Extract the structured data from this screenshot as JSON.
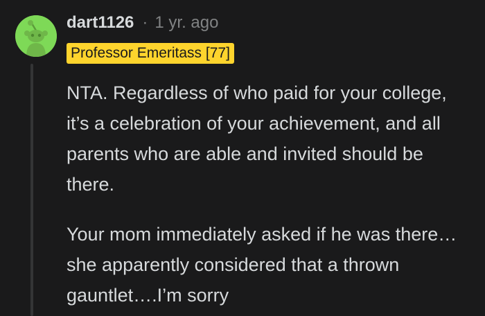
{
  "comment": {
    "username": "dart1126",
    "separator": "·",
    "timestamp": "1 yr. ago",
    "flair": "Professor Emeritass [77]",
    "paragraphs": [
      "NTA. Regardless of who paid for your college, it’s a celebration of your achievement, and all parents who are able and invited should be there.",
      "Your mom immediately asked if he was there…she apparently considered that a thrown gauntlet….I’m sorry"
    ]
  },
  "icons": {
    "avatar": "snoo-avatar-icon"
  },
  "colors": {
    "background": "#1a1a1b",
    "text": "#d7dadc",
    "muted": "#818384",
    "flair_bg": "#fed42d",
    "avatar_bg": "#7ed957",
    "thread_line": "#343536"
  }
}
